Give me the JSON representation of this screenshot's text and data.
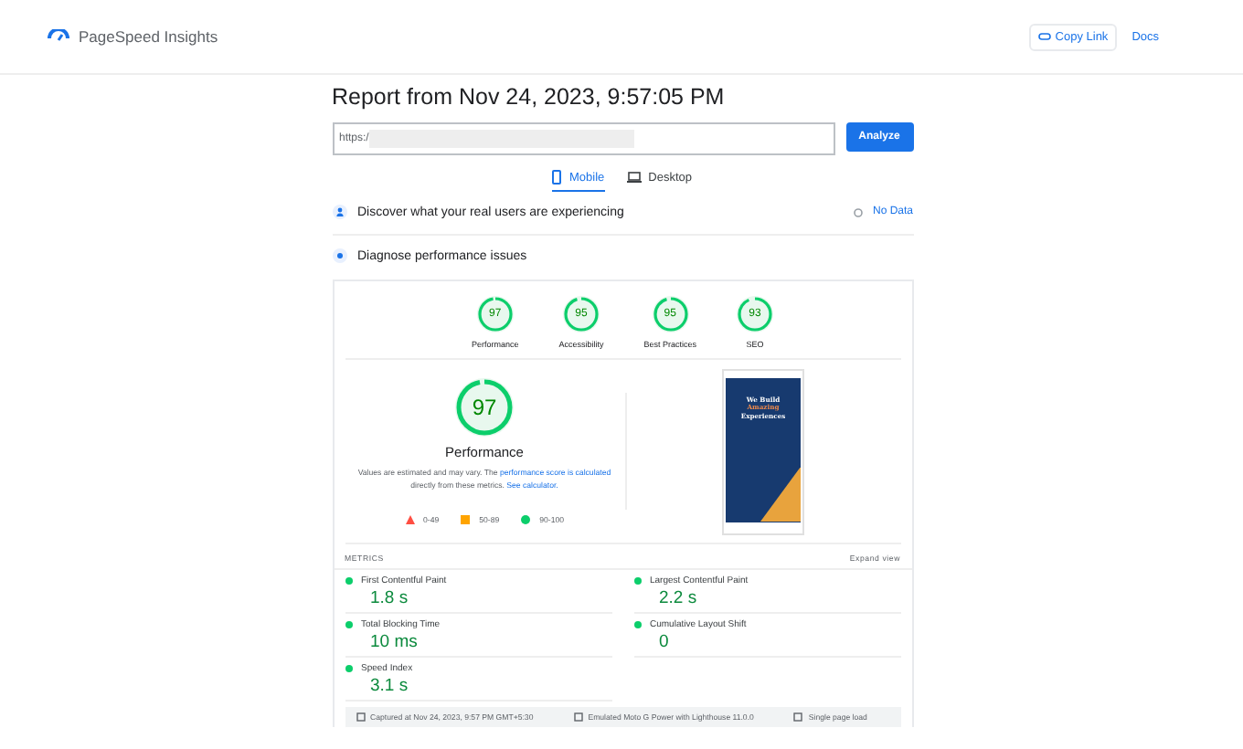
{
  "header": {
    "brand": "PageSpeed Insights",
    "copy_link": "Copy Link",
    "docs": "Docs"
  },
  "report": {
    "title": "Report from Nov 24, 2023, 9:57:05 PM",
    "url_value": "https:/",
    "analyze": "Analyze"
  },
  "tabs": [
    {
      "label": "Mobile",
      "kind": "phone",
      "selected": true
    },
    {
      "label": "Desktop",
      "kind": "laptop",
      "selected": false
    }
  ],
  "field_data": {
    "label": "Discover what your real users are experiencing",
    "status": "No Data"
  },
  "diagnose": {
    "label": "Diagnose performance issues"
  },
  "gauges": [
    {
      "score": "97",
      "label": "Performance",
      "level": 0.97
    },
    {
      "score": "95",
      "label": "Accessibility",
      "level": 0.95
    },
    {
      "score": "95",
      "label": "Best Practices",
      "level": 0.95
    },
    {
      "score": "93",
      "label": "SEO",
      "level": 0.93
    }
  ],
  "main_gauge": {
    "score": "97",
    "label": "Performance",
    "level": 0.97
  },
  "note": {
    "before": "Values are estimated and may vary. The ",
    "link1": "performance score is calculated",
    "middle": " directly from these metrics. ",
    "link2": "See calculator."
  },
  "legend": [
    {
      "kind": "triangle",
      "label": "0-49"
    },
    {
      "kind": "square",
      "label": "50-89"
    },
    {
      "kind": "circle",
      "label": "90-100"
    }
  ],
  "preview": {
    "lines": [
      "We Build",
      "Amazing",
      "Experiences"
    ]
  },
  "metrics_header": {
    "title": "METRICS",
    "expand": "Expand view"
  },
  "metrics": [
    {
      "name": "First Contentful Paint",
      "value": "1.8 s",
      "color": "#0cce6b"
    },
    {
      "name": "Largest Contentful Paint",
      "value": "2.2 s",
      "color": "#0cce6b"
    },
    {
      "name": "Total Blocking Time",
      "value": "10 ms",
      "color": "#0cce6b"
    },
    {
      "name": "Cumulative Layout Shift",
      "value": "0",
      "color": "#0cce6b"
    },
    {
      "name": "Speed Index",
      "value": "3.1 s",
      "color": "#0cce6b"
    }
  ],
  "footer": [
    "Captured at Nov 24, 2023, 9:57 PM GMT+5:30",
    "Emulated Moto G Power with Lighthouse 11.0.0",
    "Single page load"
  ]
}
